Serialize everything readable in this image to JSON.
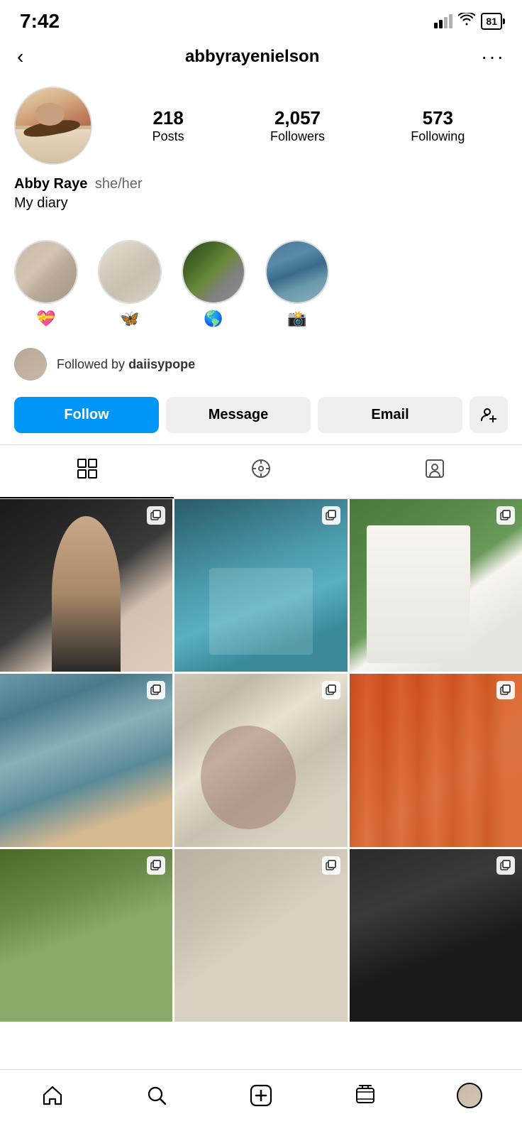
{
  "status": {
    "time": "7:42",
    "battery": "81"
  },
  "header": {
    "username": "abbyrayenielson",
    "back_label": "‹",
    "more_label": "···"
  },
  "profile": {
    "display_name": "Abby Raye",
    "pronouns": "she/her",
    "bio": "My diary",
    "stats": {
      "posts_count": "218",
      "posts_label": "Posts",
      "followers_count": "2,057",
      "followers_label": "Followers",
      "following_count": "573",
      "following_label": "Following"
    }
  },
  "highlights": [
    {
      "emoji": "💝",
      "label": "💝"
    },
    {
      "emoji": "🦋",
      "label": "🦋"
    },
    {
      "emoji": "🌎",
      "label": "🌎"
    },
    {
      "emoji": "📸",
      "label": "📸"
    }
  ],
  "followed_by": {
    "text": "Followed by ",
    "username": "daiisypope"
  },
  "buttons": {
    "follow": "Follow",
    "message": "Message",
    "email": "Email",
    "add_friend": "+"
  },
  "tabs": {
    "grid_label": "Grid",
    "reels_label": "Reels",
    "tagged_label": "Tagged"
  },
  "nav": {
    "home": "Home",
    "search": "Search",
    "add": "Add",
    "reels": "Reels",
    "profile": "Profile"
  }
}
